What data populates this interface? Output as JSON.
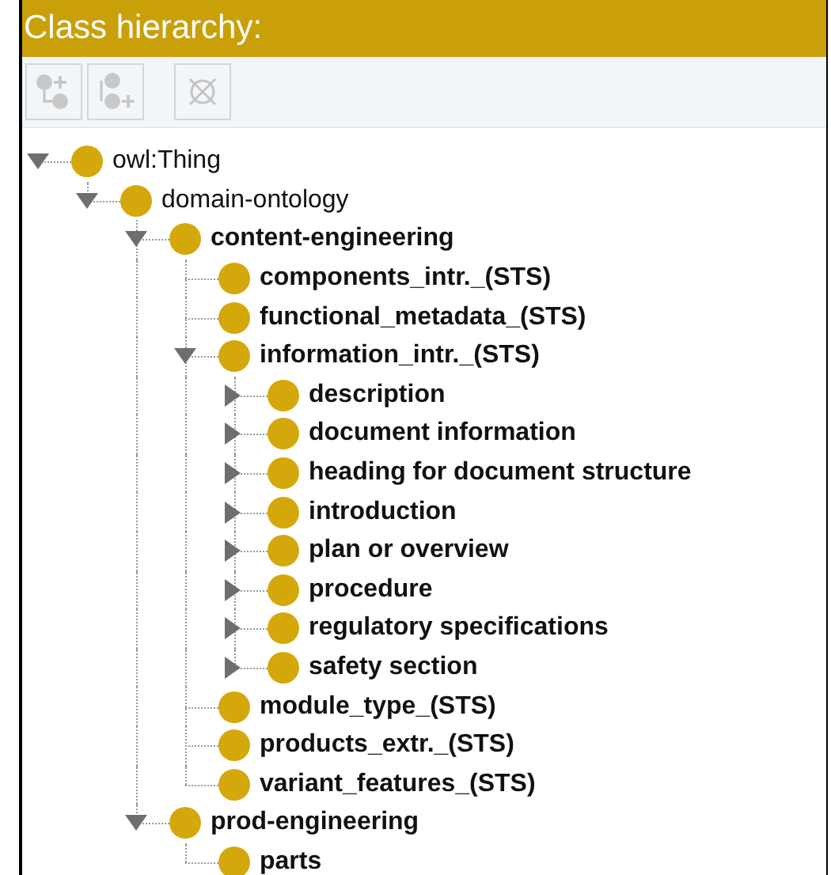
{
  "panel": {
    "title": "Class hierarchy:"
  },
  "toolbar": [
    {
      "kind": "add-subclass",
      "disabled": true
    },
    {
      "kind": "add-sibling",
      "disabled": true
    },
    {
      "kind": "delete",
      "disabled": true
    }
  ],
  "tree": [
    {
      "label": "owl:Thing",
      "kind": "open",
      "bold": false,
      "children": [
        {
          "label": "domain-ontology",
          "kind": "open",
          "bold": false,
          "children": [
            {
              "label": "content-engineering",
              "kind": "open",
              "bold": true,
              "children": [
                {
                  "label": "components_intr._(STS)",
                  "kind": "leaf",
                  "bold": true
                },
                {
                  "label": "functional_metadata_(STS)",
                  "kind": "leaf",
                  "bold": true
                },
                {
                  "label": "information_intr._(STS)",
                  "kind": "open",
                  "bold": true,
                  "children": [
                    {
                      "label": "description",
                      "kind": "closed",
                      "bold": true
                    },
                    {
                      "label": "document information",
                      "kind": "closed",
                      "bold": true
                    },
                    {
                      "label": "heading for document structure",
                      "kind": "closed",
                      "bold": true
                    },
                    {
                      "label": "introduction",
                      "kind": "closed",
                      "bold": true
                    },
                    {
                      "label": "plan or overview",
                      "kind": "closed",
                      "bold": true
                    },
                    {
                      "label": "procedure",
                      "kind": "closed",
                      "bold": true
                    },
                    {
                      "label": "regulatory specifications",
                      "kind": "closed",
                      "bold": true
                    },
                    {
                      "label": "safety section",
                      "kind": "closed",
                      "bold": true
                    }
                  ]
                },
                {
                  "label": "module_type_(STS)",
                  "kind": "leaf",
                  "bold": true
                },
                {
                  "label": "products_extr._(STS)",
                  "kind": "leaf",
                  "bold": true
                },
                {
                  "label": "variant_features_(STS)",
                  "kind": "leaf",
                  "bold": true
                }
              ]
            },
            {
              "label": "prod-engineering",
              "kind": "open",
              "bold": true,
              "children": [
                {
                  "label": "parts",
                  "kind": "leaf",
                  "bold": true
                }
              ]
            }
          ]
        }
      ]
    }
  ]
}
